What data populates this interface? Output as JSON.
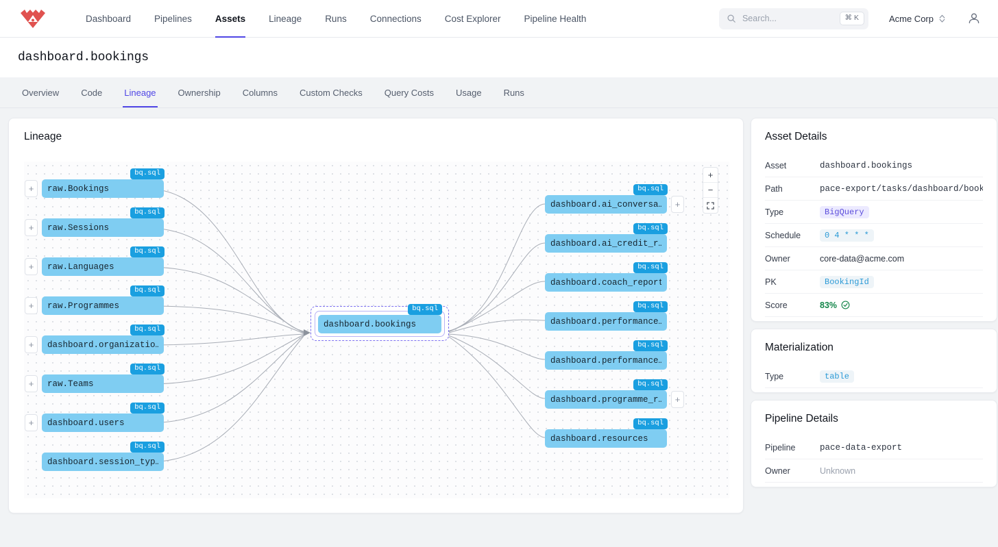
{
  "topnav": {
    "logo_name": "brand-diamond-logo",
    "items": [
      {
        "label": "Dashboard",
        "active": false
      },
      {
        "label": "Pipelines",
        "active": false
      },
      {
        "label": "Assets",
        "active": true
      },
      {
        "label": "Lineage",
        "active": false
      },
      {
        "label": "Runs",
        "active": false
      },
      {
        "label": "Connections",
        "active": false
      },
      {
        "label": "Cost Explorer",
        "active": false
      },
      {
        "label": "Pipeline Health",
        "active": false
      }
    ],
    "search": {
      "placeholder": "Search...",
      "value": "",
      "shortcut": "⌘ K"
    },
    "org": {
      "label": "Acme Corp"
    }
  },
  "header": {
    "title": "dashboard.bookings"
  },
  "tabs": [
    {
      "label": "Overview",
      "active": false
    },
    {
      "label": "Code",
      "active": false
    },
    {
      "label": "Lineage",
      "active": true
    },
    {
      "label": "Ownership",
      "active": false
    },
    {
      "label": "Columns",
      "active": false
    },
    {
      "label": "Custom Checks",
      "active": false
    },
    {
      "label": "Query Costs",
      "active": false
    },
    {
      "label": "Usage",
      "active": false
    },
    {
      "label": "Runs",
      "active": false
    }
  ],
  "lineage": {
    "title": "Lineage",
    "controls": {
      "zoom_in": "+",
      "zoom_out": "−",
      "fit_view": "fit-view"
    },
    "badge_text": "bq.sql",
    "expand_symbol": "+",
    "upstream": [
      {
        "label": "raw.Bookings",
        "badge": "bq.sql",
        "expandable": true
      },
      {
        "label": "raw.Sessions",
        "badge": "bq.sql",
        "expandable": true
      },
      {
        "label": "raw.Languages",
        "badge": "bq.sql",
        "expandable": true
      },
      {
        "label": "raw.Programmes",
        "badge": "bq.sql",
        "expandable": true
      },
      {
        "label": "dashboard.organizatio…",
        "badge": "bq.sql",
        "expandable": true
      },
      {
        "label": "raw.Teams",
        "badge": "bq.sql",
        "expandable": true
      },
      {
        "label": "dashboard.users",
        "badge": "bq.sql",
        "expandable": true
      },
      {
        "label": "dashboard.session_typ…",
        "badge": "bq.sql",
        "expandable": false
      }
    ],
    "focus": {
      "label": "dashboard.bookings",
      "badge": "bq.sql",
      "selected": true
    },
    "downstream": [
      {
        "label": "dashboard.ai_conversa…",
        "badge": "bq.sql",
        "expandable": true
      },
      {
        "label": "dashboard.ai_credit_r…",
        "badge": "bq.sql",
        "expandable": false
      },
      {
        "label": "dashboard.coach_report",
        "badge": "bq.sql",
        "expandable": false
      },
      {
        "label": "dashboard.performance…",
        "badge": "bq.sql",
        "expandable": false
      },
      {
        "label": "dashboard.performance…",
        "badge": "bq.sql",
        "expandable": false
      },
      {
        "label": "dashboard.programme_r…",
        "badge": "bq.sql",
        "expandable": true
      },
      {
        "label": "dashboard.resources",
        "badge": "bq.sql",
        "expandable": false
      }
    ]
  },
  "asset_details": {
    "title": "Asset Details",
    "rows": [
      {
        "key": "Asset",
        "value": "dashboard.bookings",
        "style": "mono"
      },
      {
        "key": "Path",
        "value": "pace-export/tasks/dashboard/book:",
        "style": "mono"
      },
      {
        "key": "Type",
        "value": "BigQuery",
        "style": "chip-violet"
      },
      {
        "key": "Schedule",
        "value": "0 4 * * *",
        "style": "chip-sky"
      },
      {
        "key": "Owner",
        "value": "core-data@acme.com",
        "style": "plain"
      },
      {
        "key": "PK",
        "value": "BookingId",
        "style": "chip-sky"
      },
      {
        "key": "Score",
        "value": "83%",
        "style": "score"
      }
    ]
  },
  "materialization": {
    "title": "Materialization",
    "rows": [
      {
        "key": "Type",
        "value": "table",
        "style": "chip-sky"
      }
    ]
  },
  "pipeline_details": {
    "title": "Pipeline Details",
    "rows": [
      {
        "key": "Pipeline",
        "value": "pace-data-export",
        "style": "mono"
      },
      {
        "key": "Owner",
        "value": "Unknown",
        "style": "muted"
      }
    ]
  },
  "colors": {
    "accent": "#4f46e5",
    "node_fill": "#7fcdf2",
    "node_badge": "#1a9fe0",
    "brand_red": "#e0524f",
    "score_green": "#14864a",
    "page_bg": "#f1f3f5"
  }
}
